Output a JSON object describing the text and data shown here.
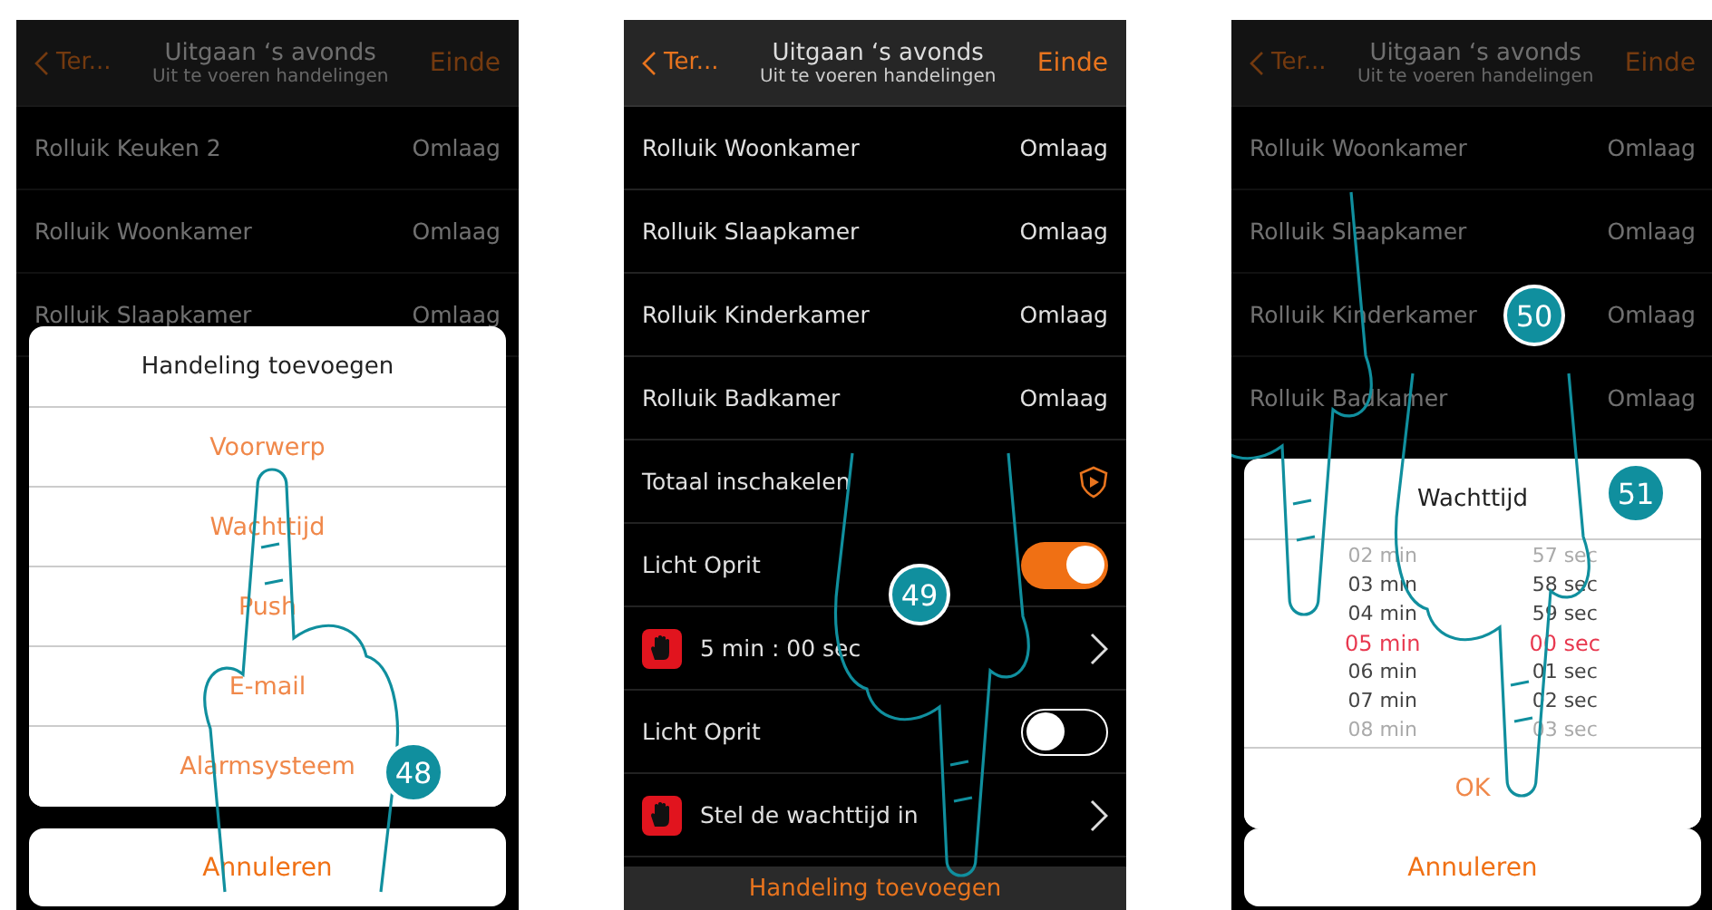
{
  "phones": [
    {
      "dimmed": true,
      "header": {
        "back": "Ter...",
        "title": "Uitgaan ‘s avonds",
        "subtitle": "Uit te voeren handelingen",
        "action": "Einde"
      },
      "rows": [
        {
          "kind": "value",
          "label": "Rolluik Keuken 2",
          "value": "Omlaag"
        },
        {
          "kind": "value",
          "label": "Rolluik Woonkamer",
          "value": "Omlaag"
        },
        {
          "kind": "value",
          "label": "Rolluik Slaapkamer",
          "value": "Omlaag"
        }
      ],
      "dialog": {
        "kind": "menu",
        "title": "Handeling toevoegen",
        "items": [
          "Voorwerp",
          "Wachttijd",
          "Push",
          "E-mail",
          "Alarmsysteem"
        ],
        "cancel": "Annuleren"
      },
      "badge": "48"
    },
    {
      "dimmed": false,
      "header": {
        "back": "Ter...",
        "title": "Uitgaan ‘s avonds",
        "subtitle": "Uit te voeren handelingen",
        "action": "Einde"
      },
      "rows": [
        {
          "kind": "value",
          "label": "Rolluik Woonkamer",
          "value": "Omlaag"
        },
        {
          "kind": "value",
          "label": "Rolluik Slaapkamer",
          "value": "Omlaag"
        },
        {
          "kind": "value",
          "label": "Rolluik Kinderkamer",
          "value": "Omlaag"
        },
        {
          "kind": "value",
          "label": "Rolluik Badkamer",
          "value": "Omlaag"
        },
        {
          "kind": "alarm",
          "label": "Totaal inschakelen"
        },
        {
          "kind": "toggle",
          "label": "Licht Oprit",
          "on": true
        },
        {
          "kind": "wait",
          "label": "5 min : 00 sec"
        },
        {
          "kind": "toggle",
          "label": "Licht Oprit",
          "on": false
        },
        {
          "kind": "wait",
          "label": "Stel de wachttijd in"
        }
      ],
      "bottom_bar": "Handeling toevoegen",
      "badge": "49"
    },
    {
      "dimmed": true,
      "header": {
        "back": "Ter...",
        "title": "Uitgaan ‘s avonds",
        "subtitle": "Uit te voeren handelingen",
        "action": "Einde"
      },
      "rows": [
        {
          "kind": "value",
          "label": "Rolluik Woonkamer",
          "value": "Omlaag"
        },
        {
          "kind": "value",
          "label": "Rolluik Slaapkamer",
          "value": "Omlaag"
        },
        {
          "kind": "value",
          "label": "Rolluik Kinderkamer",
          "value": "Omlaag"
        },
        {
          "kind": "value",
          "label": "Rolluik Badkamer",
          "value": "Omlaag"
        }
      ],
      "dialog": {
        "kind": "picker",
        "title": "Wachttijd",
        "columns": [
          [
            {
              "label": "02 min",
              "selected": false
            },
            {
              "label": "03 min",
              "selected": false
            },
            {
              "label": "04 min",
              "selected": false
            },
            {
              "label": "05 min",
              "selected": true
            },
            {
              "label": "06 min",
              "selected": false
            },
            {
              "label": "07 min",
              "selected": false
            },
            {
              "label": "08 min",
              "selected": false
            }
          ],
          [
            {
              "label": "57 sec",
              "selected": false
            },
            {
              "label": "58 sec",
              "selected": false
            },
            {
              "label": "59 sec",
              "selected": false
            },
            {
              "label": "00 sec",
              "selected": true
            },
            {
              "label": "01 sec",
              "selected": false
            },
            {
              "label": "02 sec",
              "selected": false
            },
            {
              "label": "03 sec",
              "selected": false
            }
          ]
        ],
        "ok": "OK",
        "cancel": "Annuleren"
      },
      "badge": "50",
      "badge_2": "51"
    }
  ]
}
